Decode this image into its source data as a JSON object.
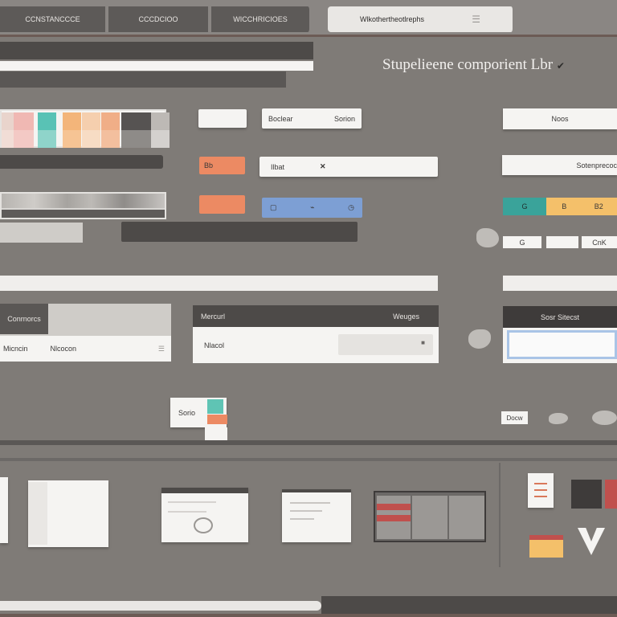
{
  "tabs": [
    {
      "label": "CCNSTANCCCE"
    },
    {
      "label": "CCCDCIOO"
    },
    {
      "label": "WICCHRICIOES"
    }
  ],
  "active_tab": {
    "label": "Wlkothertheotlrephs",
    "icon": "menu-icon"
  },
  "page_title": "Stupelieene comporient Lbr",
  "page_title_glyph": "✔",
  "buttons": {
    "boclear": "Boclear",
    "sorion": "Sorion",
    "ibat": "Ilbat",
    "orange_small": "Bb",
    "noos": "Noos",
    "sotenprec": "Sotenprecoc",
    "colors_row": [
      "G",
      "B",
      "B2"
    ],
    "small_chips": [
      "G",
      "",
      "CnK"
    ],
    "save_small": "Docw"
  },
  "panels": {
    "left_header": "Conrnorcs",
    "left_row": "Micncin",
    "left_row_right": "Nlcocon",
    "mid_header": "Mercurl",
    "mid_header_right": "Weuges",
    "mid_row": "Nlacol",
    "right_header": "Sosr Sitecst"
  },
  "card_small": "Sorio",
  "colors": {
    "orange": "#ec8a63",
    "blue": "#7d9fd4",
    "teal": "#3aa39a",
    "yellow": "#f4c06a",
    "red": "#c0504d"
  }
}
